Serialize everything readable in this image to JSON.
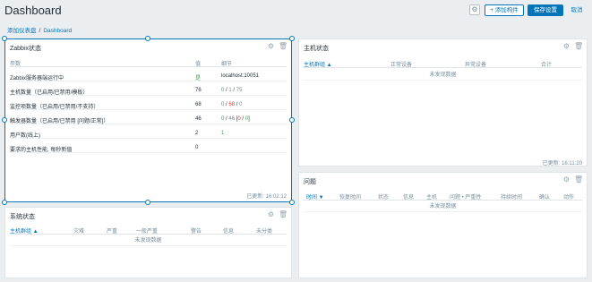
{
  "header": {
    "title": "Dashboard",
    "add_widget": "添加构件",
    "save": "保存设置",
    "cancel": "取消"
  },
  "breadcrumb": {
    "parent": "添加仪表盘",
    "current": "Dashboard"
  },
  "zabbix_status": {
    "title": "Zabbix状态",
    "columns": {
      "param": "参数",
      "value": "值",
      "detail": "细节"
    },
    "rows": [
      {
        "param": "Zabbix服务器端运行中",
        "value": "是",
        "detail": "localhost:10051"
      },
      {
        "param": "主机数量（已启用/已禁用/模板）",
        "value": "76",
        "d1": "0",
        "d2": "1",
        "d3": "75"
      },
      {
        "param": "监控项数量（已启用/已禁用/不支持）",
        "value": "68",
        "d1": "0",
        "d2": "68",
        "d3": "0"
      },
      {
        "param": "触发器数量（已启用/已禁用 [问题/正常]）",
        "value": "46",
        "d1": "0",
        "d2": "46",
        "d3": "0",
        "d4": "0"
      },
      {
        "param": "用户数(线上)",
        "value": "2",
        "d1": "1"
      },
      {
        "param": "要求的主机性能, 每秒新值",
        "value": "0"
      }
    ],
    "updated": "已更新: 16:02:12"
  },
  "host_status": {
    "title": "主机状态",
    "columns": {
      "group": "主机群组 ▲",
      "ok": "正常设备",
      "problem": "异常设备",
      "total": "合计"
    },
    "nodata": "未发现数据",
    "updated": "已更新: 16:11:20"
  },
  "system_status": {
    "title": "系统状态",
    "columns": {
      "group": "主机群组 ▲",
      "disaster": "灾难",
      "high": "严重",
      "average": "一般严重",
      "warning": "警告",
      "info": "信息",
      "unclassified": "未分类"
    },
    "nodata": "未发现数据"
  },
  "problems": {
    "title": "问题",
    "columns": {
      "time": "时间 ▼",
      "recovery": "恢复时间",
      "status": "状态",
      "info": "信息",
      "host": "主机",
      "problem": "问题 • 严重性",
      "duration": "持续时间",
      "ack": "确认",
      "actions": "动作"
    },
    "nodata": "未发现数据"
  },
  "icons": {
    "gear": "gear-icon",
    "trash": "trash-icon",
    "plus": "plus-icon"
  },
  "colors": {
    "accent": "#0275b8",
    "ok": "#429e47",
    "problem": "#e33734"
  }
}
